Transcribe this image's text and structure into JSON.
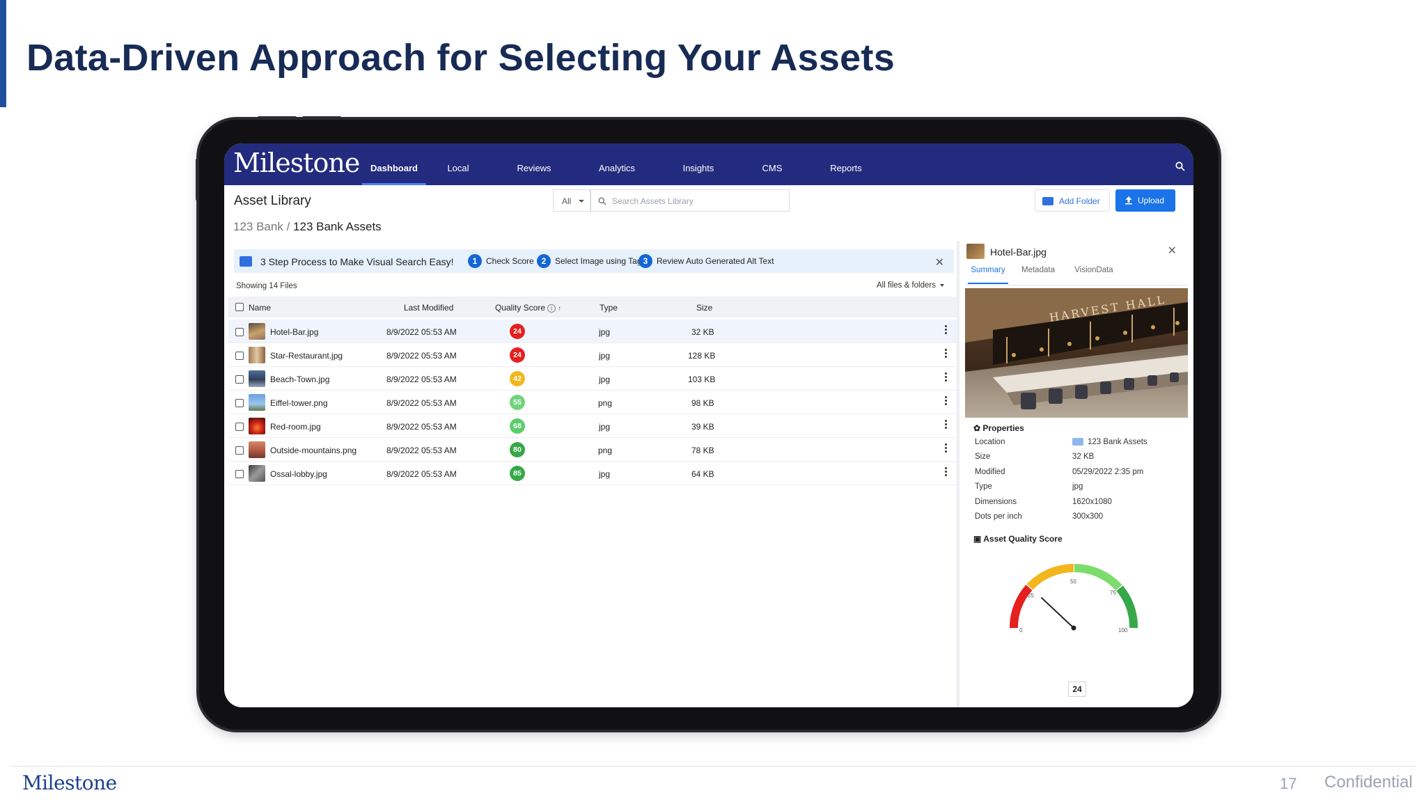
{
  "slide": {
    "title": "Data-Driven Approach for Selecting Your Assets",
    "footer_logo": "Milestone",
    "page_number": "17",
    "confidential": "Confidential"
  },
  "app": {
    "logo": "Milestone",
    "nav": [
      "Dashboard",
      "Local",
      "Reviews",
      "Analytics",
      "Insights",
      "CMS",
      "Reports"
    ],
    "active_nav": "Dashboard",
    "page_title": "Asset Library",
    "filter_value": "All",
    "search_placeholder": "Search Assets Library",
    "add_folder_label": "Add Folder",
    "upload_label": "Upload",
    "breadcrumb": {
      "root": "123 Bank",
      "separator": "/",
      "current": "123 Bank Assets"
    }
  },
  "banner": {
    "title": "3 Step Process to Make Visual Search Easy!",
    "steps": [
      {
        "num": "1",
        "label": "Check Score"
      },
      {
        "num": "2",
        "label": "Select Image using Tags"
      },
      {
        "num": "3",
        "label": "Review Auto Generated Alt Text"
      }
    ],
    "close": "✕"
  },
  "list": {
    "showing": "Showing 14 Files",
    "scope": "All files & folders",
    "headers": {
      "name": "Name",
      "modified": "Last Modified",
      "score": "Quality Score",
      "type": "Type",
      "size": "Size"
    },
    "rows": [
      {
        "name": "Hotel-Bar.jpg",
        "modified": "8/9/2022 05:53 AM",
        "score": "24",
        "type": "jpg",
        "size": "32 KB",
        "score_color": "#e5201f"
      },
      {
        "name": "Star-Restaurant.jpg",
        "modified": "8/9/2022 05:53 AM",
        "score": "24",
        "type": "jpg",
        "size": "128 KB",
        "score_color": "#e5201f"
      },
      {
        "name": "Beach-Town.jpg",
        "modified": "8/9/2022 05:53 AM",
        "score": "42",
        "type": "jpg",
        "size": "103 KB",
        "score_color": "#f2b71e"
      },
      {
        "name": "Eiffel-tower.png",
        "modified": "8/9/2022 05:53 AM",
        "score": "55",
        "type": "png",
        "size": "98 KB",
        "score_color": "#6fd47a"
      },
      {
        "name": "Red-room.jpg",
        "modified": "8/9/2022 05:53 AM",
        "score": "68",
        "type": "jpg",
        "size": "39 KB",
        "score_color": "#5ccd6a"
      },
      {
        "name": "Outside-mountains.png",
        "modified": "8/9/2022 05:53 AM",
        "score": "80",
        "type": "png",
        "size": "78 KB",
        "score_color": "#37a849"
      },
      {
        "name": "Ossal-lobby.jpg",
        "modified": "8/9/2022 05:53 AM",
        "score": "85",
        "type": "jpg",
        "size": "64 KB",
        "score_color": "#37a849"
      }
    ]
  },
  "details": {
    "title": "Hotel-Bar.jpg",
    "close": "✕",
    "tabs": [
      "Summary",
      "Metadata",
      "VisionData"
    ],
    "active_tab": "Summary",
    "preview_sign": "HARVEST HALL",
    "properties_heading": "Properties",
    "properties": [
      {
        "key": "Location",
        "value": "123 Bank Assets"
      },
      {
        "key": "Size",
        "value": "32 KB"
      },
      {
        "key": "Modified",
        "value": "05/29/2022 2:35 pm"
      },
      {
        "key": "Type",
        "value": "jpg"
      },
      {
        "key": "Dimensions",
        "value": "1620x1080"
      },
      {
        "key": "Dots per inch",
        "value": "300x300"
      }
    ],
    "quality_heading": "Asset Quality Score",
    "gauge": {
      "value": 24,
      "max": 100,
      "ticks": [
        "0",
        "25",
        "50",
        "75",
        "100"
      ]
    }
  }
}
